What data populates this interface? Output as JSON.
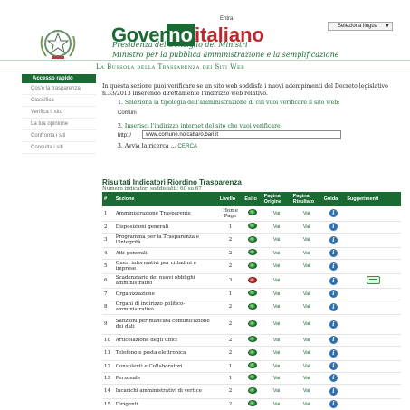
{
  "header": {
    "entra": "Entra",
    "logo_part1": "Gover",
    "logo_part2": "no",
    "logo_part3": "italiano",
    "subtitle1": "Presidenza del Consiglio dei Ministri",
    "subtitle2": "Ministro per la pubblica amministrazione e la semplificazione",
    "language_select": "Seleziona lingua",
    "colors": {
      "brand_green": "#1a6a34",
      "brand_red": "#c0272d"
    }
  },
  "band": {
    "title": "La Bussola della Trasparenza dei Siti Web"
  },
  "sidebar": {
    "heading": "Accesso rapido",
    "items": [
      {
        "label": "Cos'è la trasparenza"
      },
      {
        "label": "Classifica"
      },
      {
        "label": "Verifica il sito"
      },
      {
        "label": "La tua opinione"
      },
      {
        "label": "Confronta i siti"
      },
      {
        "label": "Consulta i siti"
      }
    ]
  },
  "main": {
    "intro": "In questa sezione puoi verificare se un sito web soddisfa i nuovi adempimenti del Decreto legislativo n.33/2013 inserendo direttamente l'indirizzo web relativo.",
    "step1_num": "1.",
    "step1": "Seleziona la tipologia dell'amministrazione di cui vuoi verificare il sito web:",
    "step1_value": "Comuni",
    "step2_num": "2.",
    "step2": "Inserisci l'indirizzo internet del sito che vuoi verificare:",
    "http_label": "http://",
    "url_value": "www.comune.noicattaro.bari.it",
    "step3_num": "3.",
    "step3": "Avvia la ricerca ...",
    "cerca": "CERCA"
  },
  "results": {
    "title": "Risultati Indicatori Riordino Trasparenza",
    "count": "Numero indicatori soddisfatti: 60 su 67",
    "columns": [
      "#",
      "Sezione",
      "Livello",
      "Esito",
      "Pagina Origine",
      "Pagina Risultato",
      "Guida",
      "Suggerimenti"
    ],
    "rows": [
      {
        "n": "1",
        "sezione": "Amministrazione Trasparente",
        "livello": "Home Page",
        "esito": "ok",
        "origine": "Vai",
        "risultato": "Vai",
        "sugg": false
      },
      {
        "n": "2",
        "sezione": "Disposizioni generali",
        "livello": "1",
        "esito": "ok",
        "origine": "Vai",
        "risultato": "Vai",
        "sugg": false
      },
      {
        "n": "3",
        "sezione": "Programma per la Trasparenza e l'Integrità",
        "livello": "2",
        "esito": "ok",
        "origine": "Vai",
        "risultato": "Vai",
        "sugg": false
      },
      {
        "n": "4",
        "sezione": "Atti generali",
        "livello": "2",
        "esito": "ok",
        "origine": "Vai",
        "risultato": "Vai",
        "sugg": false
      },
      {
        "n": "5",
        "sezione": "Oneri informativi per cittadini e imprese",
        "livello": "2",
        "esito": "ok",
        "origine": "Vai",
        "risultato": "Vai",
        "sugg": false
      },
      {
        "n": "6",
        "sezione": "Scadenziario dei nuovi obblighi amministrativi",
        "livello": "3",
        "esito": "fail",
        "origine": "Vai",
        "risultato": "",
        "sugg": true
      },
      {
        "n": "7",
        "sezione": "Organizzazione",
        "livello": "1",
        "esito": "ok",
        "origine": "Vai",
        "risultato": "Vai",
        "sugg": false
      },
      {
        "n": "8",
        "sezione": "Organi di indirizzo politico-amministrativo",
        "livello": "2",
        "esito": "ok",
        "origine": "Vai",
        "risultato": "Vai",
        "sugg": false
      },
      {
        "n": "9",
        "sezione": "Sanzioni per mancata comunicazione dei dati",
        "livello": "2",
        "esito": "ok",
        "origine": "Vai",
        "risultato": "Vai",
        "sugg": false
      },
      {
        "n": "10",
        "sezione": "Articolazione degli uffici",
        "livello": "2",
        "esito": "ok",
        "origine": "Vai",
        "risultato": "Vai",
        "sugg": false
      },
      {
        "n": "11",
        "sezione": "Telefono e posta elettronica",
        "livello": "2",
        "esito": "ok",
        "origine": "Vai",
        "risultato": "Vai",
        "sugg": false
      },
      {
        "n": "12",
        "sezione": "Consulenti e Collaboratori",
        "livello": "1",
        "esito": "ok",
        "origine": "Vai",
        "risultato": "Vai",
        "sugg": false
      },
      {
        "n": "13",
        "sezione": "Personale",
        "livello": "1",
        "esito": "ok",
        "origine": "Vai",
        "risultato": "Vai",
        "sugg": false
      },
      {
        "n": "14",
        "sezione": "Incarichi amministrativi di vertice",
        "livello": "2",
        "esito": "ok",
        "origine": "Vai",
        "risultato": "Vai",
        "sugg": false
      },
      {
        "n": "15",
        "sezione": "Dirigenti",
        "livello": "2",
        "esito": "ok",
        "origine": "Vai",
        "risultato": "Vai",
        "sugg": false
      }
    ]
  }
}
